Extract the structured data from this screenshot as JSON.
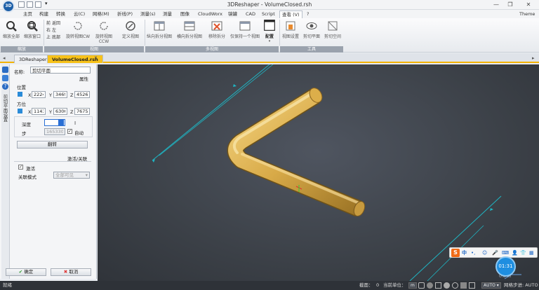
{
  "titlebar": {
    "logo": "3D",
    "title": "3DReshaper - VolumeClosed.rsh",
    "minimize": "—",
    "restore": "❐",
    "close": "✕",
    "qa_more": "▾"
  },
  "menu": {
    "tabs": [
      "主页",
      "构建",
      "转换",
      "云(C)",
      "网格(M)",
      "折线(P)",
      "测量(s)",
      "测量",
      "图像",
      "CloudWorx",
      "镜罐",
      "CAD",
      "Script",
      "查看 (V)",
      "?"
    ],
    "active_index": 13,
    "theme": "Theme ▾"
  },
  "ribbon": {
    "zoom_all": "缩放全部",
    "zoom_window": "缩放窗口",
    "back": "返回",
    "front": "前",
    "right": "右",
    "left": "左",
    "top": "上",
    "bottom": "底部",
    "rotate_cw": "旋转视图CW",
    "rotate_ccw": "旋转视图CCW",
    "define_view": "定义视图",
    "vsplit": "纵向拆分视图",
    "hsplit": "横向拆分视图",
    "remove_split": "移除拆分",
    "single_view": "仅保持一个视图",
    "config": "配置",
    "view_settings": "视图设置",
    "clip_plane": "剪切平面",
    "clip_space": "剪切空间",
    "group_zoom": "缩放",
    "group_view": "视图",
    "group_multi": "多视图",
    "group_tools": "工具"
  },
  "doc_tabs": [
    {
      "label": "3DReshaper1",
      "active": false
    },
    {
      "label": "VolumeClosed.rsh",
      "active": true
    }
  ],
  "panel": {
    "vertical_title": "剪切平面设置",
    "name_label": "名称:",
    "name_value": "剪切平面",
    "props_label": "属性",
    "position_label": "位置",
    "pos_x_label": "X",
    "pos_x": "22249",
    "pos_y_label": "Y",
    "pos_y": "34692",
    "pos_z_label": "Z",
    "pos_z": "45269",
    "direction_label": "方位",
    "dir_x_label": "X",
    "dir_x": "11437",
    "dir_y_label": "Y",
    "dir_y": "63069",
    "dir_z_label": "Z",
    "dir_z": "76756",
    "depth_label": "深度",
    "depth_value": "",
    "step_label": "步",
    "step_value": "1653303",
    "auto_label": "自动",
    "auto_checked": true,
    "flip_button": "翻转",
    "activate_section": "激活/关联",
    "activate_label": "激活",
    "activate_checked": true,
    "link_mode_label": "关联模式",
    "link_mode_value": "全部可见",
    "ok_button": "确定",
    "cancel_button": "取消"
  },
  "viewport": {
    "scale_label": "0.8 m"
  },
  "ime": {
    "logo": "S",
    "mode": "中",
    "punct": "•,",
    "emoji": "☺",
    "voice": "🎤",
    "keyboard": "⌨",
    "user": "👤",
    "shirt": "👕",
    "grid": "▦"
  },
  "clock": "01:31",
  "statusbar": {
    "ready": "就绪",
    "section_label": "截面：",
    "section_value": "0",
    "unit_label": "当前单位：",
    "unit_value": "m",
    "auto1": "AUTO",
    "step_label": "网格步进",
    "auto2": "AUTO"
  },
  "colors": {
    "accent": "#f7c21a",
    "tube": "#d9ac4a",
    "plane_line": "#1fb5c3"
  }
}
